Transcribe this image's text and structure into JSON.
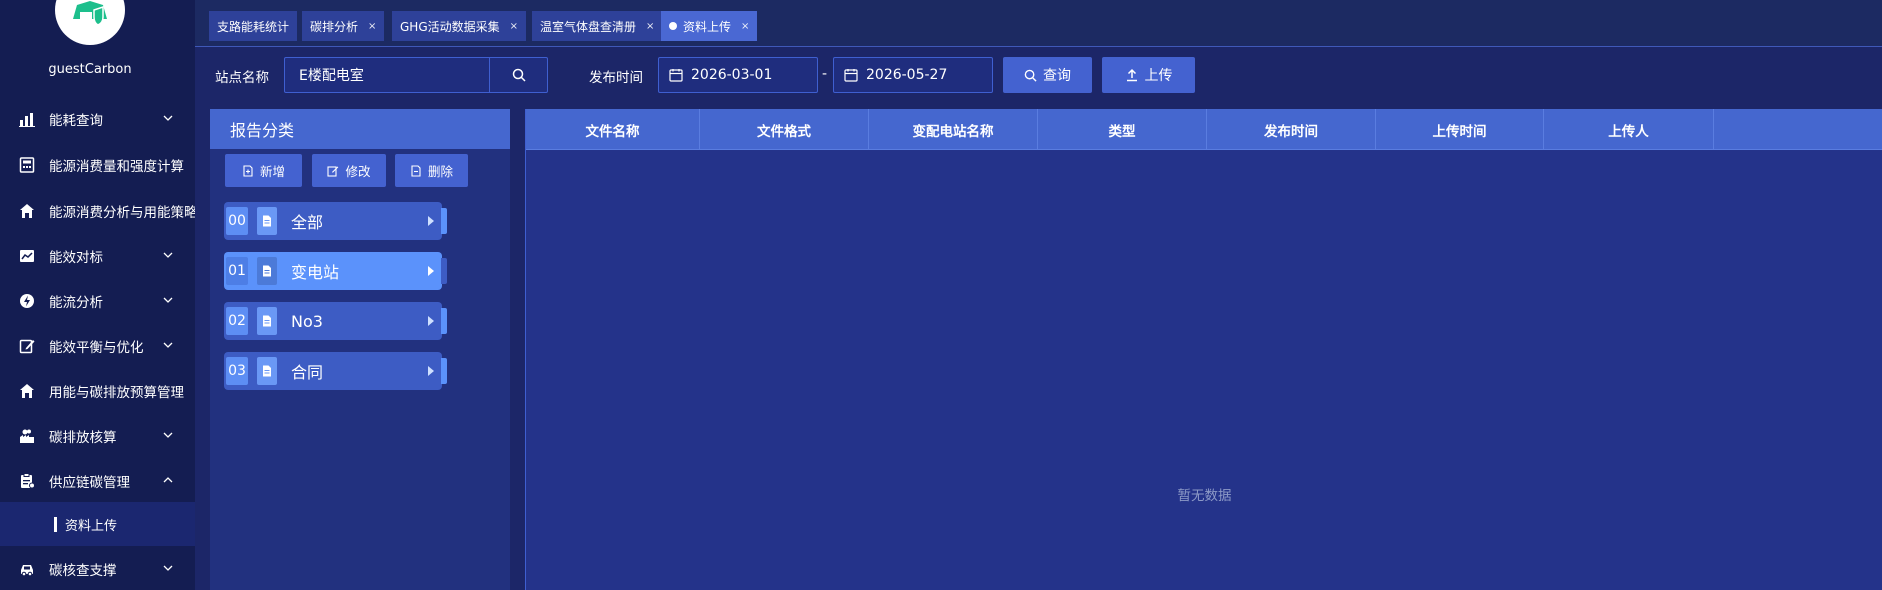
{
  "user": {
    "name": "guestCarbon"
  },
  "sidebar": {
    "items": [
      {
        "label": "能耗查询",
        "icon": "chart-bar-icon",
        "expandable": true
      },
      {
        "label": "能源消费量和强度计算",
        "icon": "calculator-icon",
        "expandable": false
      },
      {
        "label": "能源消费分析与用能策略",
        "icon": "home-icon",
        "expandable": false
      },
      {
        "label": "能效对标",
        "icon": "trend-chart-icon",
        "expandable": true
      },
      {
        "label": "能流分析",
        "icon": "energy-bolt-icon",
        "expandable": true
      },
      {
        "label": "能效平衡与优化",
        "icon": "edit-icon",
        "expandable": true
      },
      {
        "label": "用能与碳排放预算管理",
        "icon": "home-icon",
        "expandable": false
      },
      {
        "label": "碳排放核算",
        "icon": "factory-icon",
        "expandable": true
      },
      {
        "label": "供应链碳管理",
        "icon": "clipboard-icon",
        "expandable": true,
        "expanded": true
      },
      {
        "label": "碳核查支撑",
        "icon": "car-icon",
        "expandable": true
      }
    ],
    "submenu": {
      "label": "资料上传"
    }
  },
  "tabs": [
    {
      "label": "支路能耗统计",
      "closable": false
    },
    {
      "label": "碳排分析",
      "closable": true
    },
    {
      "label": "GHG活动数据采集",
      "closable": true
    },
    {
      "label": "温室气体盘查清册",
      "closable": true
    },
    {
      "label": "资料上传",
      "closable": true,
      "active": true
    }
  ],
  "filters": {
    "station_label": "站点名称",
    "station_value": "E楼配电室",
    "publish_time_label": "发布时间",
    "date_start": "2026-03-01",
    "date_sep": "-",
    "date_end": "2026-05-27",
    "query_button": "查询",
    "upload_button": "上传"
  },
  "report_panel": {
    "title": "报告分类",
    "add_button": "新增",
    "edit_button": "修改",
    "delete_button": "删除",
    "categories": [
      {
        "num": "00",
        "name": "全部"
      },
      {
        "num": "01",
        "name": "变电站",
        "selected": true
      },
      {
        "num": "02",
        "name": "No3"
      },
      {
        "num": "03",
        "name": "合同"
      }
    ]
  },
  "table": {
    "columns": [
      "文件名称",
      "文件格式",
      "变配电站名称",
      "类型",
      "发布时间",
      "上传时间",
      "上传人"
    ],
    "rows": [],
    "empty_text": "暂无数据"
  },
  "colors": {
    "sidebar_bg": "#141d52",
    "main_bg": "#1c2668",
    "accent": "#4462d0",
    "selected": "#5b92fb"
  }
}
